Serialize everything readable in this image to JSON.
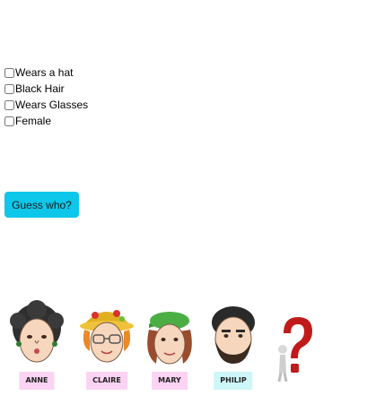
{
  "filters": [
    {
      "label": "Wears a hat",
      "checked": false
    },
    {
      "label": "Black Hair",
      "checked": false
    },
    {
      "label": "Wears Glasses",
      "checked": false
    },
    {
      "label": "Female",
      "checked": false
    }
  ],
  "guess_button": {
    "label": "Guess who?",
    "color": "#0dc7ea"
  },
  "characters": [
    {
      "name": "ANNE",
      "tag_color": "#fbd3f3"
    },
    {
      "name": "CLAIRE",
      "tag_color": "#fbd3f3"
    },
    {
      "name": "MARY",
      "tag_color": "#fbd3f3"
    },
    {
      "name": "PHILIP",
      "tag_color": "#cdf6f8"
    }
  ],
  "mystery_icon": "question-mark-figure-icon"
}
